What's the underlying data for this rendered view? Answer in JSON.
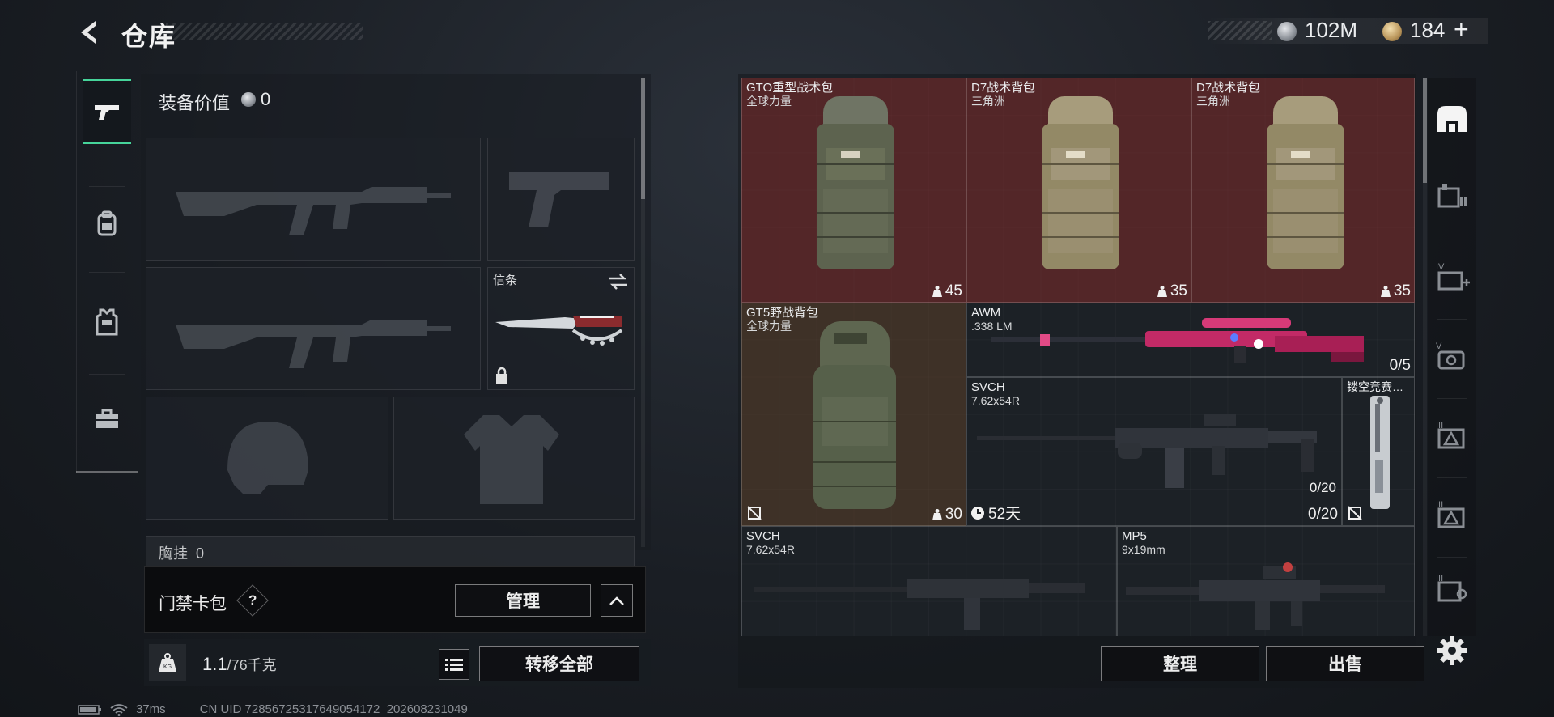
{
  "header": {
    "title": "仓库",
    "back_icon": "back-arrow-icon"
  },
  "currency": {
    "silver": "102M",
    "gold": "184",
    "plus": "+"
  },
  "left_rail": {
    "tabs": [
      "weapons",
      "backpack",
      "armor-vest",
      "toolbox"
    ]
  },
  "loadout": {
    "equip_value_label": "装备价值",
    "equip_value": "0",
    "melee_slot_label": "信条",
    "chest_rig_label": "胸挂",
    "chest_rig_count": "0",
    "card_pack_label": "门禁卡包",
    "help": "?",
    "manage_label": "管理",
    "weight_value": "1.1",
    "weight_capacity": "/76千克",
    "kg_badge": "KG",
    "transfer_all_label": "转移全部"
  },
  "warehouse": {
    "items": [
      {
        "name": "GTO重型战术包",
        "sub": "全球力量",
        "count": "45",
        "tone": "red"
      },
      {
        "name": "D7战术背包",
        "sub": "三角洲",
        "count": "35",
        "tone": "red"
      },
      {
        "name": "D7战术背包",
        "sub": "三角洲",
        "count": "35",
        "tone": "red"
      },
      {
        "name": "GT5野战背包",
        "sub": "全球力量",
        "count": "30",
        "tone": "brown"
      },
      {
        "name": "AWM",
        "sub": ".338 LM",
        "count": "0/5",
        "tone": "dark"
      },
      {
        "name": "SVCH",
        "sub": "7.62x54R",
        "count": "0/20",
        "inner_count": "0/20",
        "timer": "52天",
        "tone": "dark"
      },
      {
        "name": "镂空竞赛…",
        "sub": "",
        "tone": "dark"
      },
      {
        "name": "SVCH",
        "sub": "7.62x54R",
        "tone": "dark"
      },
      {
        "name": "MP5",
        "sub": "9x19mm",
        "tone": "dark"
      }
    ],
    "sort_label": "整理",
    "sell_label": "出售"
  },
  "right_rail": {
    "tier_labels": [
      "IV",
      "V",
      "III",
      "III",
      "III"
    ]
  },
  "status_bar": {
    "ping": "37ms",
    "uid": "CN UID 7285672531764905417​2_202608231049"
  },
  "colors": {
    "accent": "#46d49a",
    "red_item": "#662a2c",
    "brown_item": "#4a3728"
  }
}
